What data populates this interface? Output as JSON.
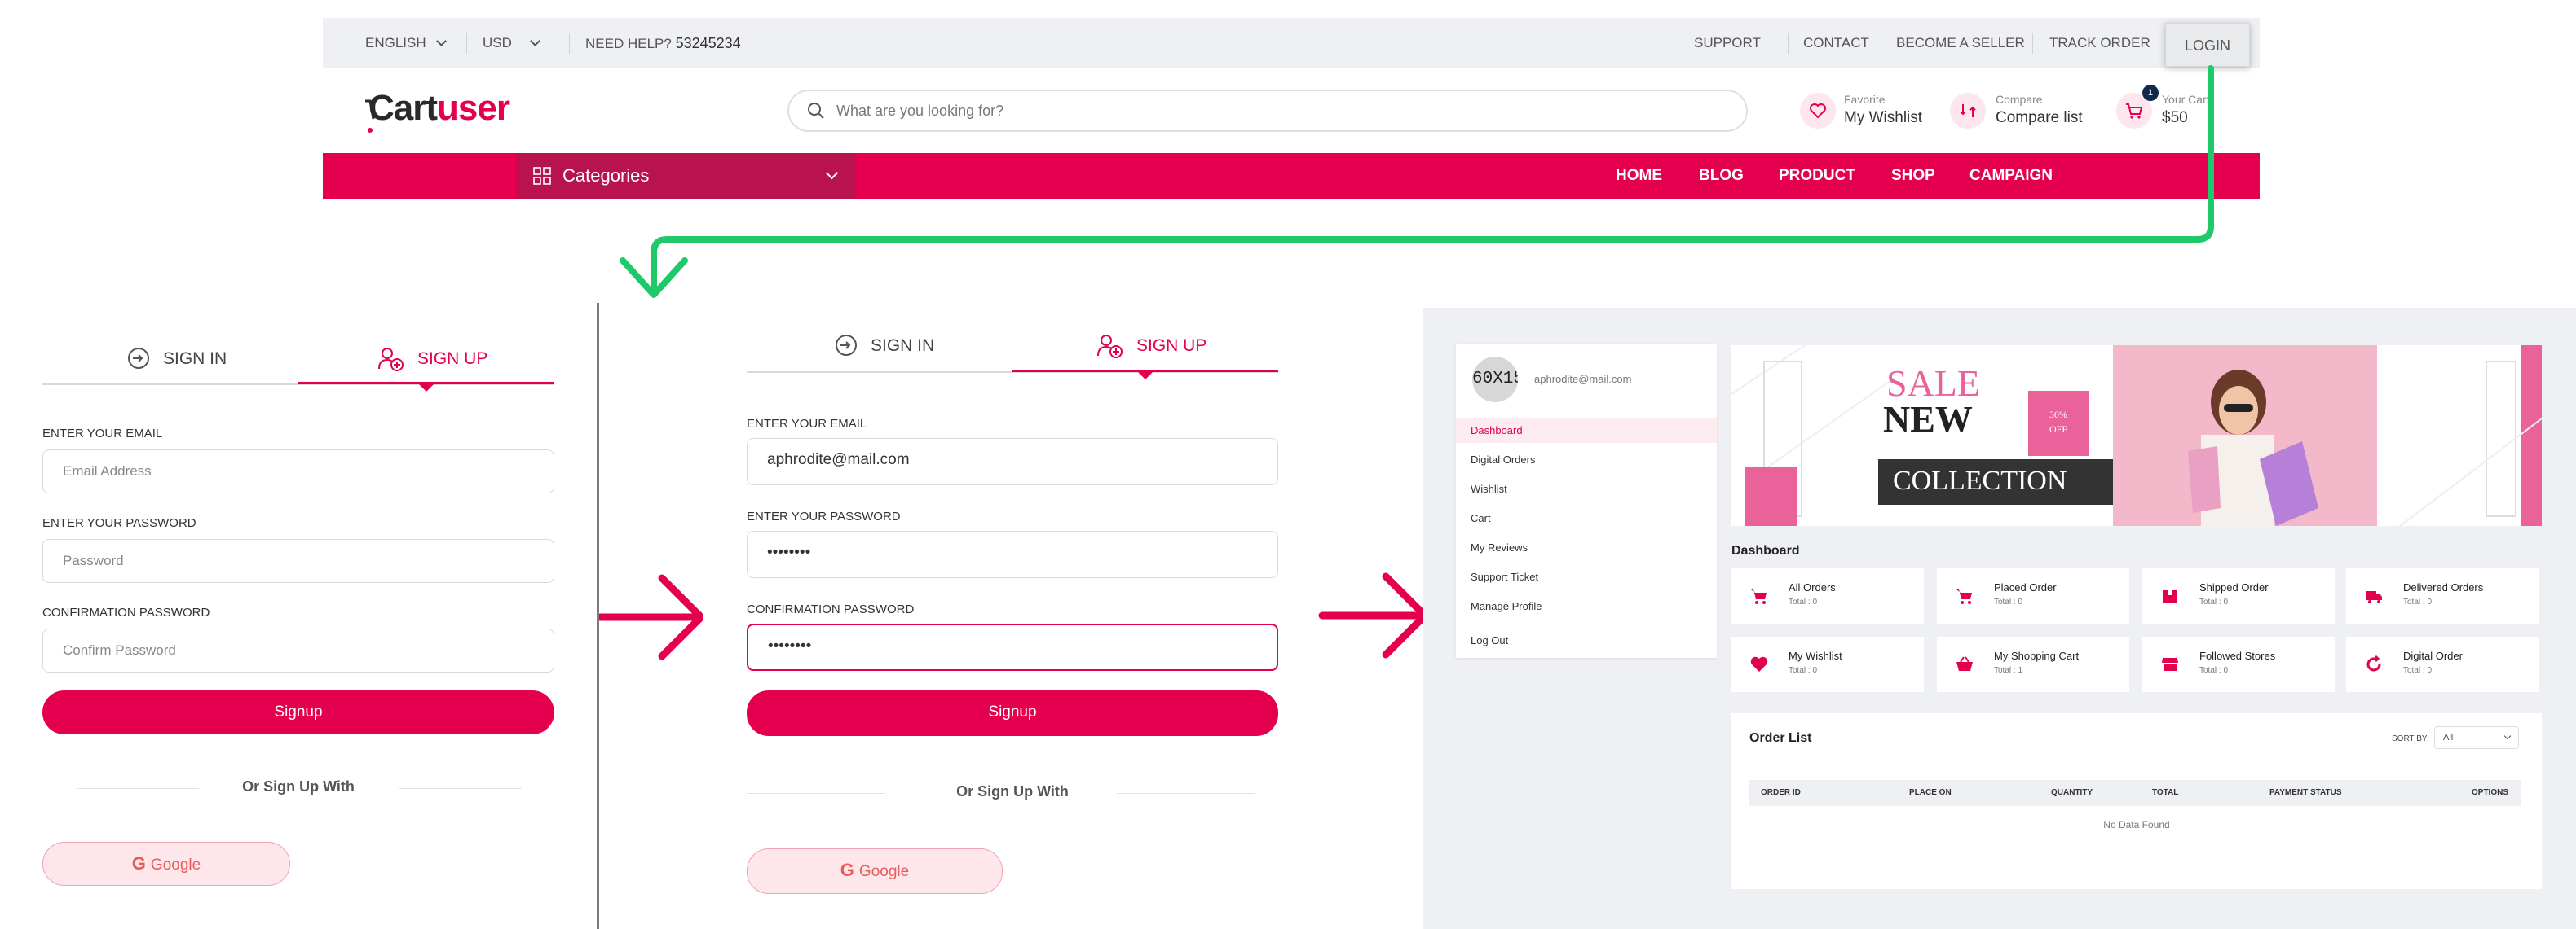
{
  "colors": {
    "brand": "#e4004f",
    "category_bg": "#b8134f",
    "arrow_green": "#1ec96a",
    "dash_bg": "#eff0f3"
  },
  "topbar": {
    "language": "ENGLISH",
    "currency": "USD",
    "help_label": "NEED HELP?",
    "help_number": "53245234",
    "links": [
      "SUPPORT",
      "CONTACT",
      "BECOME A SELLER",
      "TRACK ORDER"
    ],
    "login": "LOGIN"
  },
  "header": {
    "logo_part1": "Cart",
    "logo_part2": "user",
    "search_placeholder": "What are you looking for?",
    "favorite_small": "Favorite",
    "favorite_big": "My Wishlist",
    "compare_small": "Compare",
    "compare_big": "Compare list",
    "cart_small": "Your Cart",
    "cart_big": "$50",
    "cart_badge": "1"
  },
  "nav": {
    "categories": "Categories",
    "links": [
      "HOME",
      "BLOG",
      "PRODUCT",
      "SHOP",
      "CAMPAIGN"
    ]
  },
  "auth_empty": {
    "tab_signin": "SIGN IN",
    "tab_signup": "SIGN UP",
    "email_label": "ENTER YOUR EMAIL",
    "email_placeholder": "Email Address",
    "password_label": "ENTER YOUR PASSWORD",
    "password_placeholder": "Password",
    "confirm_label": "CONFIRMATION PASSWORD",
    "confirm_placeholder": "Confirm Password",
    "signup_button": "Signup",
    "or_text": "Or Sign Up With",
    "google": "Google"
  },
  "auth_filled": {
    "tab_signin": "SIGN IN",
    "tab_signup": "SIGN UP",
    "email_label": "ENTER YOUR EMAIL",
    "email_value": "aphrodite@mail.com",
    "password_label": "ENTER YOUR PASSWORD",
    "password_value": "••••••••",
    "confirm_label": "CONFIRMATION PASSWORD",
    "confirm_value": "••••••••",
    "signup_button": "Signup",
    "or_text": "Or Sign Up With",
    "google": "Google"
  },
  "dashboard": {
    "avatar_text": "60X15",
    "email": "aphrodite@mail.com",
    "menu": [
      "Dashboard",
      "Digital Orders",
      "Wishlist",
      "Cart",
      "My Reviews",
      "Support Ticket",
      "Manage Profile"
    ],
    "logout": "Log Out",
    "banner": {
      "line1": "SALE",
      "line2": "NEW",
      "line3": "COLLECTION",
      "badge_top": "30%",
      "badge_bottom": "OFF"
    },
    "title": "Dashboard",
    "cards": [
      {
        "title": "All Orders",
        "sub": "Total : 0",
        "icon": "cart-icon"
      },
      {
        "title": "Placed Order",
        "sub": "Total : 0",
        "icon": "cart-icon"
      },
      {
        "title": "Shipped Order",
        "sub": "Total : 0",
        "icon": "box-icon"
      },
      {
        "title": "Delivered Orders",
        "sub": "Total : 0",
        "icon": "truck-icon"
      },
      {
        "title": "My Wishlist",
        "sub": "Total : 0",
        "icon": "heart-icon"
      },
      {
        "title": "My Shopping Cart",
        "sub": "Total : 1",
        "icon": "basket-icon"
      },
      {
        "title": "Followed Stores",
        "sub": "Total : 0",
        "icon": "store-icon"
      },
      {
        "title": "Digital Order",
        "sub": "Total : 0",
        "icon": "refresh-icon"
      }
    ],
    "orders": {
      "title": "Order List",
      "sort_label": "SORT BY:",
      "sort_value": "All",
      "columns": [
        "ORDER ID",
        "PLACE ON",
        "QUANTITY",
        "TOTAL",
        "PAYMENT STATUS",
        "OPTIONS"
      ],
      "empty": "No Data Found"
    }
  }
}
